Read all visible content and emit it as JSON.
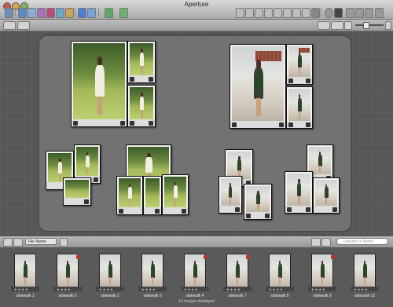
{
  "window": {
    "title": "Aperture"
  },
  "colors": {
    "accent": "#b23a2b",
    "canvas": "#727272",
    "background": "#565656"
  },
  "toolbar": {
    "left_icons": [
      "import-icon",
      "new-project-icon",
      "new-folder-icon",
      "new-album-icon",
      "new-smart-album-icon",
      "light-table-icon",
      "book-icon",
      "web-icon",
      "email-icon",
      "export-icon"
    ],
    "right_icons": [
      "select-tool-icon",
      "rotate-tool-icon",
      "straighten-tool-icon",
      "crop-tool-icon",
      "red-eye-tool-icon",
      "retouch-tool-icon",
      "lift-tool-icon",
      "stamp-tool-icon",
      "loupe-icon",
      "fullscreen-icon"
    ]
  },
  "light_table": {
    "groups": [
      {
        "kind": "park",
        "photos": 3
      },
      {
        "kind": "street",
        "photos": 3
      },
      {
        "kind": "park",
        "photos": 4
      },
      {
        "kind": "park",
        "photos": 4
      },
      {
        "kind": "street",
        "photos": 5
      },
      {
        "kind": "street",
        "photos": 5
      }
    ]
  },
  "browser_bar": {
    "sort_label": "File Name",
    "search_placeholder": "Unrated or Better"
  },
  "filmstrip": {
    "items": [
      {
        "name": "sidewalk 1",
        "stars": "★ ★ ★ ★",
        "flag": false
      },
      {
        "name": "sidewalk 5",
        "stars": "★ ★ ★ ★",
        "flag": true
      },
      {
        "name": "sidewalk 2",
        "stars": "★ ★ ★ ★",
        "flag": false
      },
      {
        "name": "sidewalk 3",
        "stars": "★ ★ ★ ★",
        "flag": false
      },
      {
        "name": "sidewalk 4",
        "stars": "★ ★ ★ ★",
        "flag": true
      },
      {
        "name": "sidewalk 7",
        "stars": "★ ★ ★ ★",
        "flag": true
      },
      {
        "name": "sidewalk 8",
        "stars": "★ ★ ★ ★",
        "flag": false
      },
      {
        "name": "sidewalk 9",
        "stars": "★ ★ ★ ★",
        "flag": true
      },
      {
        "name": "sidewalk 12",
        "stars": "★ ★ ★ ★",
        "flag": false
      }
    ],
    "status": "16 images displayed"
  }
}
